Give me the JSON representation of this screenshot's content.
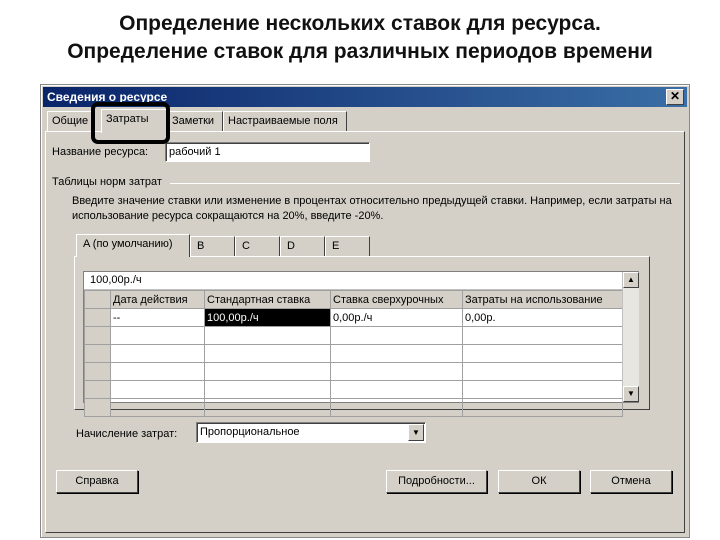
{
  "slide": {
    "title_line1": "Определение нескольких ставок для ресурса.",
    "title_line2": "Определение ставок для различных периодов времени"
  },
  "dialog": {
    "title": "Сведения о ресурсе",
    "close_glyph": "✕",
    "tabs": [
      "Общие",
      "Затраты",
      "Заметки",
      "Настраиваемые поля"
    ],
    "active_tab": "Затраты",
    "resource_name_label": "Название ресурса:",
    "resource_name_value": "рабочий 1",
    "rate_tables_label": "Таблицы норм затрат",
    "instructions": "Введите значение ставки или изменение в процентах относительно предыдущей ставки. Например, если затраты на использование ресурса сокращаются на 20%, введите -20%.",
    "rate_tabs": [
      "A (по умолчанию)",
      "B",
      "C",
      "D",
      "E"
    ],
    "active_rate_tab": "A (по умолчанию)",
    "edit_value": "100,00р./ч",
    "columns": [
      "Дата действия",
      "Стандартная ставка",
      "Ставка сверхурочных",
      "Затраты на использование"
    ],
    "rows": [
      [
        "--",
        "100,00р./ч",
        "0,00р./ч",
        "0,00р."
      ]
    ],
    "empty_rows": 5,
    "cost_accrual_label": "Начисление затрат:",
    "cost_accrual_value": "Пропорциональное",
    "buttons": {
      "help": "Справка",
      "details": "Подробности...",
      "ok": "ОК",
      "cancel": "Отмена"
    }
  }
}
